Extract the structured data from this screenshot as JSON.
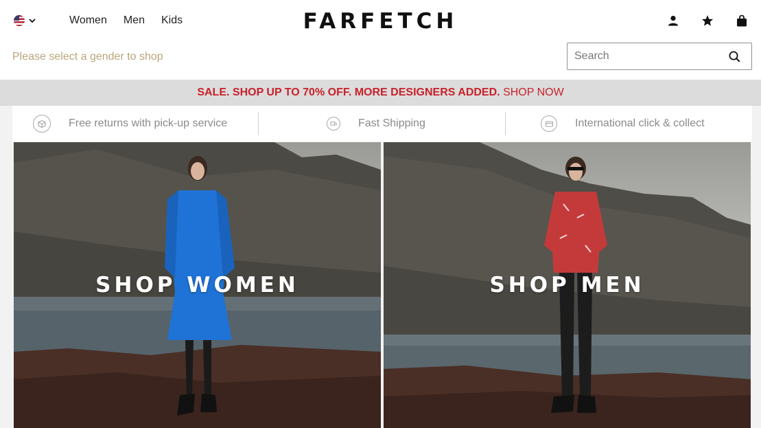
{
  "header": {
    "locale_flag": "us-flag-icon",
    "gender_nav": [
      "Women",
      "Men",
      "Kids"
    ],
    "logo": "FARFETCH",
    "gender_hint": "Please select a gender to shop",
    "search": {
      "placeholder": "Search",
      "value": ""
    },
    "icons": [
      "account-icon",
      "wishlist-star-icon",
      "shopping-bag-icon"
    ]
  },
  "promo": {
    "sale_text": "SALE. SHOP UP TO 70% OFF. MORE DESIGNERS ADDED.",
    "cta": "SHOP NOW",
    "background": "#dcdcdc",
    "accent": "#c8202a"
  },
  "services": [
    {
      "label": "Free returns with pick-up service",
      "icon": "returns-box-icon"
    },
    {
      "label": "Fast Shipping",
      "icon": "fast-shipping-icon"
    },
    {
      "label": "International click & collect",
      "icon": "click-collect-icon"
    }
  ],
  "hero": {
    "women_label": "SHOP WOMEN",
    "men_label": "SHOP MEN"
  },
  "colors": {
    "hint": "#b9a57c",
    "text": "#222222",
    "service_text": "#8a8a8a"
  }
}
